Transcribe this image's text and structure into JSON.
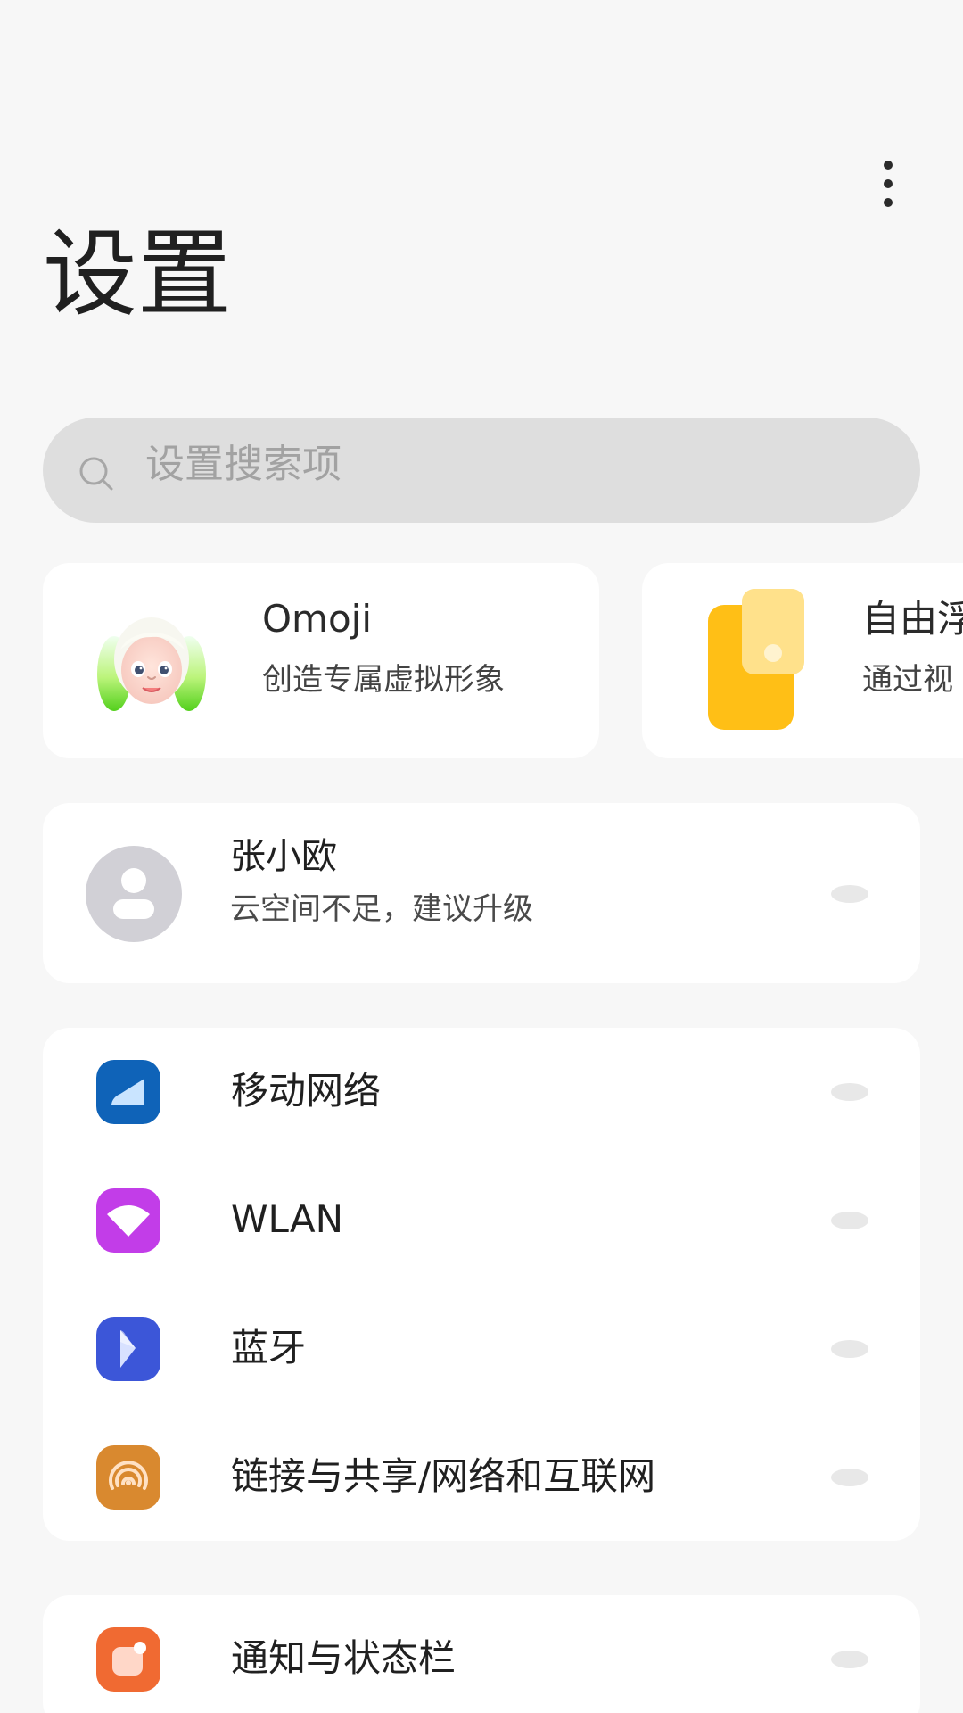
{
  "header": {
    "more_icon": "more-vertical-icon",
    "title": "设置"
  },
  "search": {
    "placeholder": "设置搜索项",
    "icon": "search-icon"
  },
  "promos": [
    {
      "title": "Omoji",
      "subtitle": "创造专属虚拟形象",
      "icon": "omoji-avatar-icon"
    },
    {
      "title": "自由浮",
      "subtitle": "通过视",
      "icon": "floating-window-icon"
    }
  ],
  "account": {
    "name": "张小欧",
    "status": "云空间不足，建议升级",
    "icon": "user-avatar-icon"
  },
  "settings": {
    "network": [
      {
        "label": "移动网络",
        "icon": "mobile-network-icon",
        "color": "#0f63b8"
      },
      {
        "label": "WLAN",
        "icon": "wifi-icon",
        "color": "#c23de8"
      },
      {
        "label": "蓝牙",
        "icon": "bluetooth-icon",
        "color": "#3c56d8"
      },
      {
        "label": "链接与共享/网络和互联网",
        "icon": "sharing-icon",
        "color": "#d9892f"
      }
    ],
    "notification": {
      "label": "通知与状态栏",
      "icon": "notification-icon",
      "color": "#f06a32"
    }
  },
  "colors": {
    "background": "#f7f7f7",
    "card": "#ffffff",
    "search": "#dedede",
    "text": "#202020",
    "placeholder": "#a2a2a2"
  }
}
